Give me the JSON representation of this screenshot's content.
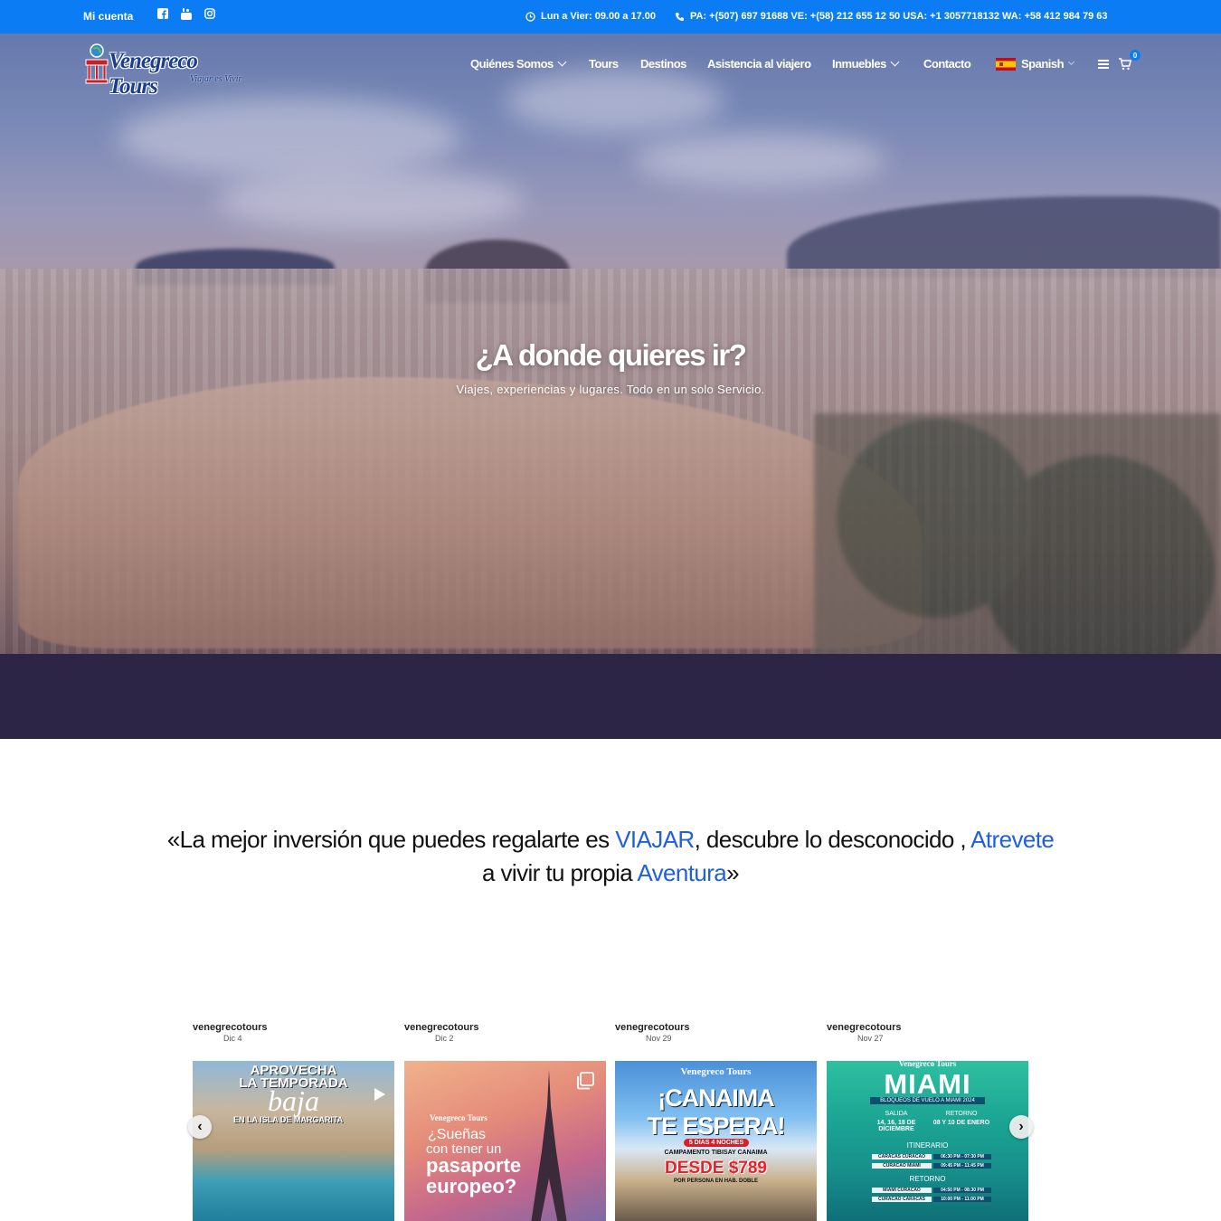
{
  "topbar": {
    "account": "Mi cuenta",
    "social": [
      "facebook-icon",
      "youtube-icon",
      "instagram-icon"
    ],
    "hours": "Lun a Vier: 09.00 a 17.00",
    "phones": "PA: +(507) 697 91688 VE: +(58) 212 655 12 50 USA: +1 3057718132 WA: +58 412 984 79 63"
  },
  "logo": {
    "name": "Venegreco Tours",
    "tagline": "Viajar es Vivir"
  },
  "nav": {
    "items": [
      {
        "label": "Quiénes Somos",
        "dropdown": true
      },
      {
        "label": "Tours",
        "dropdown": false
      },
      {
        "label": "Destinos",
        "dropdown": false
      },
      {
        "label": "Asistencia al viajero",
        "dropdown": false
      },
      {
        "label": "Inmuebles",
        "dropdown": true
      },
      {
        "label": "Contacto",
        "dropdown": false
      }
    ],
    "language": "Spanish",
    "cart_count": "0"
  },
  "hero": {
    "title": "¿A donde quieres ir?",
    "subtitle": "Viajes, experiencias y lugares. Todo en un solo Servicio."
  },
  "quote": {
    "part1": "«La mejor inversión que puedes regalarte es ",
    "hl1": "VIAJAR",
    "part2": ", descubre lo desconocido , ",
    "hl2": "Atrevete",
    "part3": " a vivir tu propia ",
    "hl3": "Aventura",
    "part4": "»"
  },
  "feed": {
    "posts": [
      {
        "user": "venegrecotours",
        "date": "Dic 4",
        "lines": [
          "APROVECHA",
          "LA TEMPORADA",
          "baja",
          "EN LA ISLA DE MARGARITA"
        ]
      },
      {
        "user": "venegrecotours",
        "date": "Dic 2",
        "lines": [
          "Venegreco Tours",
          "¿Sueñas",
          "con tener un",
          "pasaporte",
          "europeo?"
        ]
      },
      {
        "user": "venegrecotours",
        "date": "Nov 29",
        "lines": [
          "Venegreco Tours",
          "¡CANAIMA",
          "TE ESPERA!",
          "5 DIAS 4 NOCHES",
          "CAMPAMENTO TIBISAY CANAIMA",
          "DESDE $789",
          "POR PERSONA EN HAB. DOBLE"
        ]
      },
      {
        "user": "venegrecotours",
        "date": "Nov 27",
        "lines": [
          "Venegreco Tours",
          "MIAMI",
          "BLOQUEOS DE VUELO A MIAMI 2024",
          "SALIDA",
          "14, 16, 18 DE DICIEMBRE",
          "RETORNO",
          "08 Y 10 DE ENERO",
          "ITINERARIO",
          "CARACAS CURACAO",
          "06:30 PM - 07:30 PM",
          "CURACAO MIAMI",
          "09:45 PM - 11:45 PM",
          "RETORNO",
          "MIAMI CURACAO",
          "04:50 PM - 08:30 PM",
          "CURACAO CARACAS",
          "10:00 PM - 11:00 PM"
        ]
      }
    ]
  }
}
